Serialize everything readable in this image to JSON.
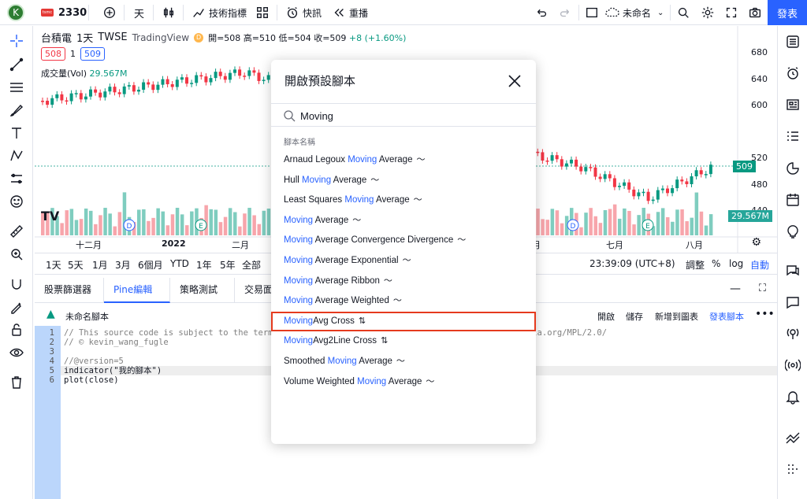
{
  "topbar": {
    "avatar": "K",
    "symbol": "2330",
    "interval": "天",
    "indicators_label": "技術指標",
    "alert_label": "快訊",
    "replay_label": "重播",
    "layout_name": "未命名",
    "publish_label": "發表"
  },
  "chart": {
    "symbol_name": "台積電",
    "interval": "1天",
    "exchange": "TWSE",
    "source": "TradingView",
    "badge": "D",
    "ohlc": "開=508 高=510 低=504 收=509",
    "change": "+8 (+1.60%)",
    "bid": "508",
    "spread": "1",
    "ask": "509",
    "volume_label": "成交量(Vol)",
    "volume_value": "29.567M",
    "price_ticks": [
      "680",
      "640",
      "600",
      "520",
      "480",
      "440"
    ],
    "last_price": "509",
    "volume_tag": "29.567M",
    "time_ticks": [
      "十二月",
      "2022",
      "二月",
      "六月",
      "七月",
      "八月"
    ]
  },
  "ranges": {
    "items": [
      "1天",
      "5天",
      "1月",
      "3月",
      "6個月",
      "YTD",
      "1年",
      "5年",
      "全部"
    ],
    "time": "23:39:09 (UTC+8)",
    "adjust": "調整",
    "percent": "%",
    "log": "log",
    "auto": "自動"
  },
  "bottom": {
    "tabs": [
      "股票篩選器",
      "Pine編輯器",
      "策略測試器",
      "交易面"
    ],
    "script_name": "未命名腳本",
    "actions": [
      "開啟",
      "儲存",
      "新增到圖表",
      "發表腳本"
    ]
  },
  "editor": {
    "lines": [
      {
        "n": "1",
        "text": "// This source code is subject to the terms of the Mozilla Public License 2.0 at https://mozilla.org/MPL/2.0/"
      },
      {
        "n": "2",
        "text": "// © kevin_wang_fugle"
      },
      {
        "n": "3",
        "text": ""
      },
      {
        "n": "4",
        "text": "//@version=5"
      },
      {
        "n": "5",
        "text": "indicator(\"我的腳本\")"
      },
      {
        "n": "6",
        "text": "plot(close)"
      }
    ]
  },
  "modal": {
    "title": "開啟預設腳本",
    "search_value": "Moving",
    "section_header": "腳本名稱",
    "items": [
      {
        "pre": "Arnaud Legoux ",
        "hi": "Moving",
        "post": " Average",
        "icon": "〜"
      },
      {
        "pre": "Hull ",
        "hi": "Moving",
        "post": " Average",
        "icon": "〜"
      },
      {
        "pre": "Least Squares ",
        "hi": "Moving",
        "post": " Average",
        "icon": "〜"
      },
      {
        "pre": "",
        "hi": "Moving",
        "post": " Average",
        "icon": "〜"
      },
      {
        "pre": "",
        "hi": "Moving",
        "post": " Average Convergence Divergence",
        "icon": "〜"
      },
      {
        "pre": "",
        "hi": "Moving",
        "post": " Average Exponential",
        "icon": "〜"
      },
      {
        "pre": "",
        "hi": "Moving",
        "post": " Average Ribbon",
        "icon": "〜"
      },
      {
        "pre": "",
        "hi": "Moving",
        "post": " Average Weighted",
        "icon": "〜"
      },
      {
        "pre": "",
        "hi": "Moving",
        "post": "Avg Cross",
        "icon": "⇅"
      },
      {
        "pre": "",
        "hi": "Moving",
        "post": "Avg2Line Cross",
        "icon": "⇅"
      },
      {
        "pre": "Smoothed ",
        "hi": "Moving",
        "post": " Average",
        "icon": "〜"
      },
      {
        "pre": "Volume Weighted ",
        "hi": "Moving",
        "post": " Average",
        "icon": "〜"
      }
    ],
    "selected_index": 8
  },
  "colors": {
    "accent": "#2962ff",
    "up": "#089981",
    "down": "#f23645",
    "highlight": "#e53a1e"
  }
}
